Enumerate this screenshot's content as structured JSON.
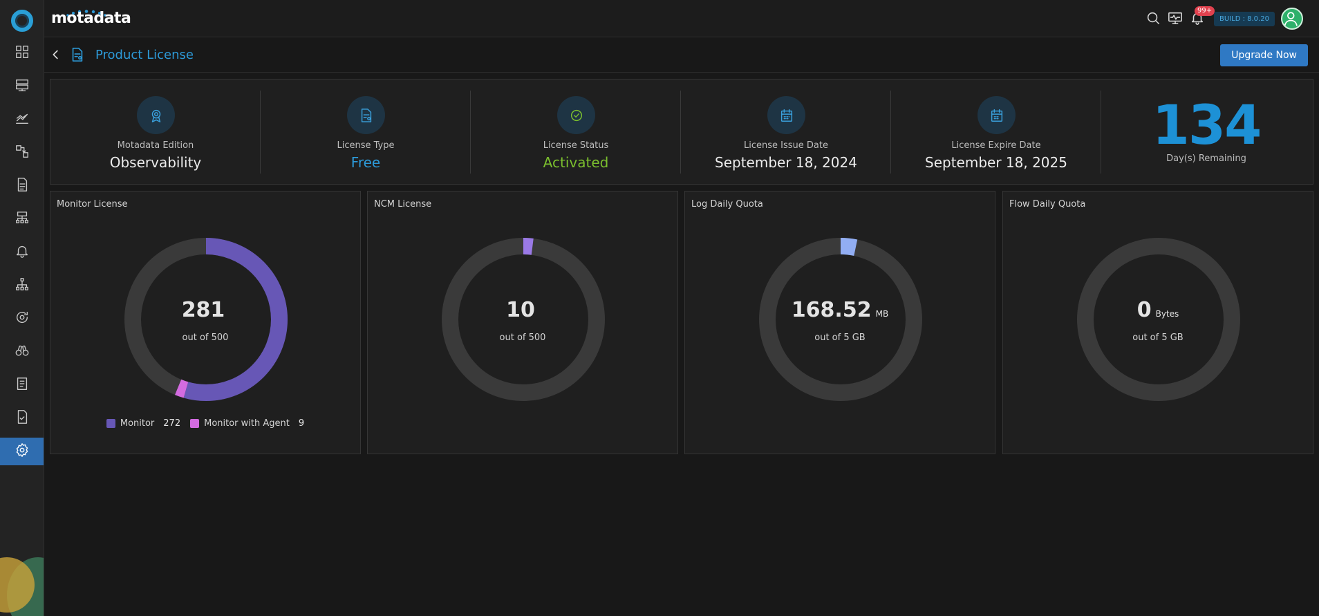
{
  "app": {
    "brand": "motadata",
    "build": "BUILD : 8.0.20",
    "notifications": "99+"
  },
  "header": {
    "title": "Product License",
    "upgrade_label": "Upgrade Now"
  },
  "summary": {
    "edition_label": "Motadata Edition",
    "edition_value": "Observability",
    "type_label": "License Type",
    "type_value": "Free",
    "status_label": "License Status",
    "status_value": "Activated",
    "issue_label": "License Issue Date",
    "issue_value": "September 18, 2024",
    "expire_label": "License Expire Date",
    "expire_value": "September 18, 2025",
    "days_value": "134",
    "days_label": "Day(s) Remaining"
  },
  "colors": {
    "track": "#3a3a3a",
    "monitor": "#6757b6",
    "monitor_agent": "#d36be0",
    "ncm": "#9a79e6",
    "log": "#92aef3"
  },
  "cards": [
    {
      "title": "Monitor License",
      "value": "281",
      "unit": "",
      "sub": "out of 500",
      "total": 500,
      "segments": [
        {
          "value": 272,
          "color": "#6757b6"
        },
        {
          "value": 9,
          "color": "#d36be0"
        }
      ],
      "legend": [
        {
          "label": "Monitor",
          "count": "272",
          "color": "#6757b6"
        },
        {
          "label": "Monitor with Agent",
          "count": "9",
          "color": "#d36be0"
        }
      ]
    },
    {
      "title": "NCM License",
      "value": "10",
      "unit": "",
      "sub": "out of 500",
      "total": 500,
      "segments": [
        {
          "value": 10,
          "color": "#9a79e6"
        }
      ]
    },
    {
      "title": "Log Daily Quota",
      "value": "168.52",
      "unit": "MB",
      "sub": "out of 5 GB",
      "total": 5120,
      "segments": [
        {
          "value": 168.52,
          "color": "#92aef3"
        }
      ]
    },
    {
      "title": "Flow Daily Quota",
      "value": "0",
      "unit": "Bytes",
      "sub": "out of 5 GB",
      "total": 5120,
      "segments": []
    }
  ],
  "nav_icons": [
    "dashboard-icon",
    "server-icon",
    "metrics-icon",
    "flow-icon",
    "report-icon",
    "topology-icon",
    "alert-icon",
    "network-icon",
    "discovery-icon",
    "explorer-icon",
    "audit-icon",
    "compliance-icon",
    "settings-icon"
  ]
}
